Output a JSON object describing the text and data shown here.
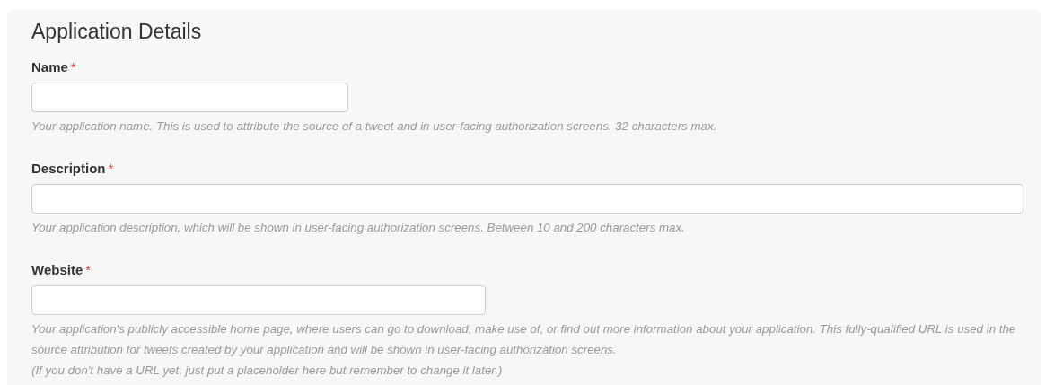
{
  "section": {
    "title": "Application Details"
  },
  "fields": [
    {
      "label": "Name",
      "required_mark": "*",
      "help": [
        "Your application name. This is used to attribute the source of a tweet and in user-facing authorization screens. 32 characters max."
      ]
    },
    {
      "label": "Description",
      "required_mark": "*",
      "help": [
        "Your application description, which will be shown in user-facing authorization screens. Between 10 and 200 characters max."
      ]
    },
    {
      "label": "Website",
      "required_mark": "*",
      "help": [
        "Your application's publicly accessible home page, where users can go to download, make use of, or find out more information about your application. This fully-qualified URL is used in the source attribution for tweets created by your application and will be shown in user-facing authorization screens.",
        "(If you don't have a URL yet, just put a placeholder here but remember to change it later.)"
      ]
    }
  ]
}
